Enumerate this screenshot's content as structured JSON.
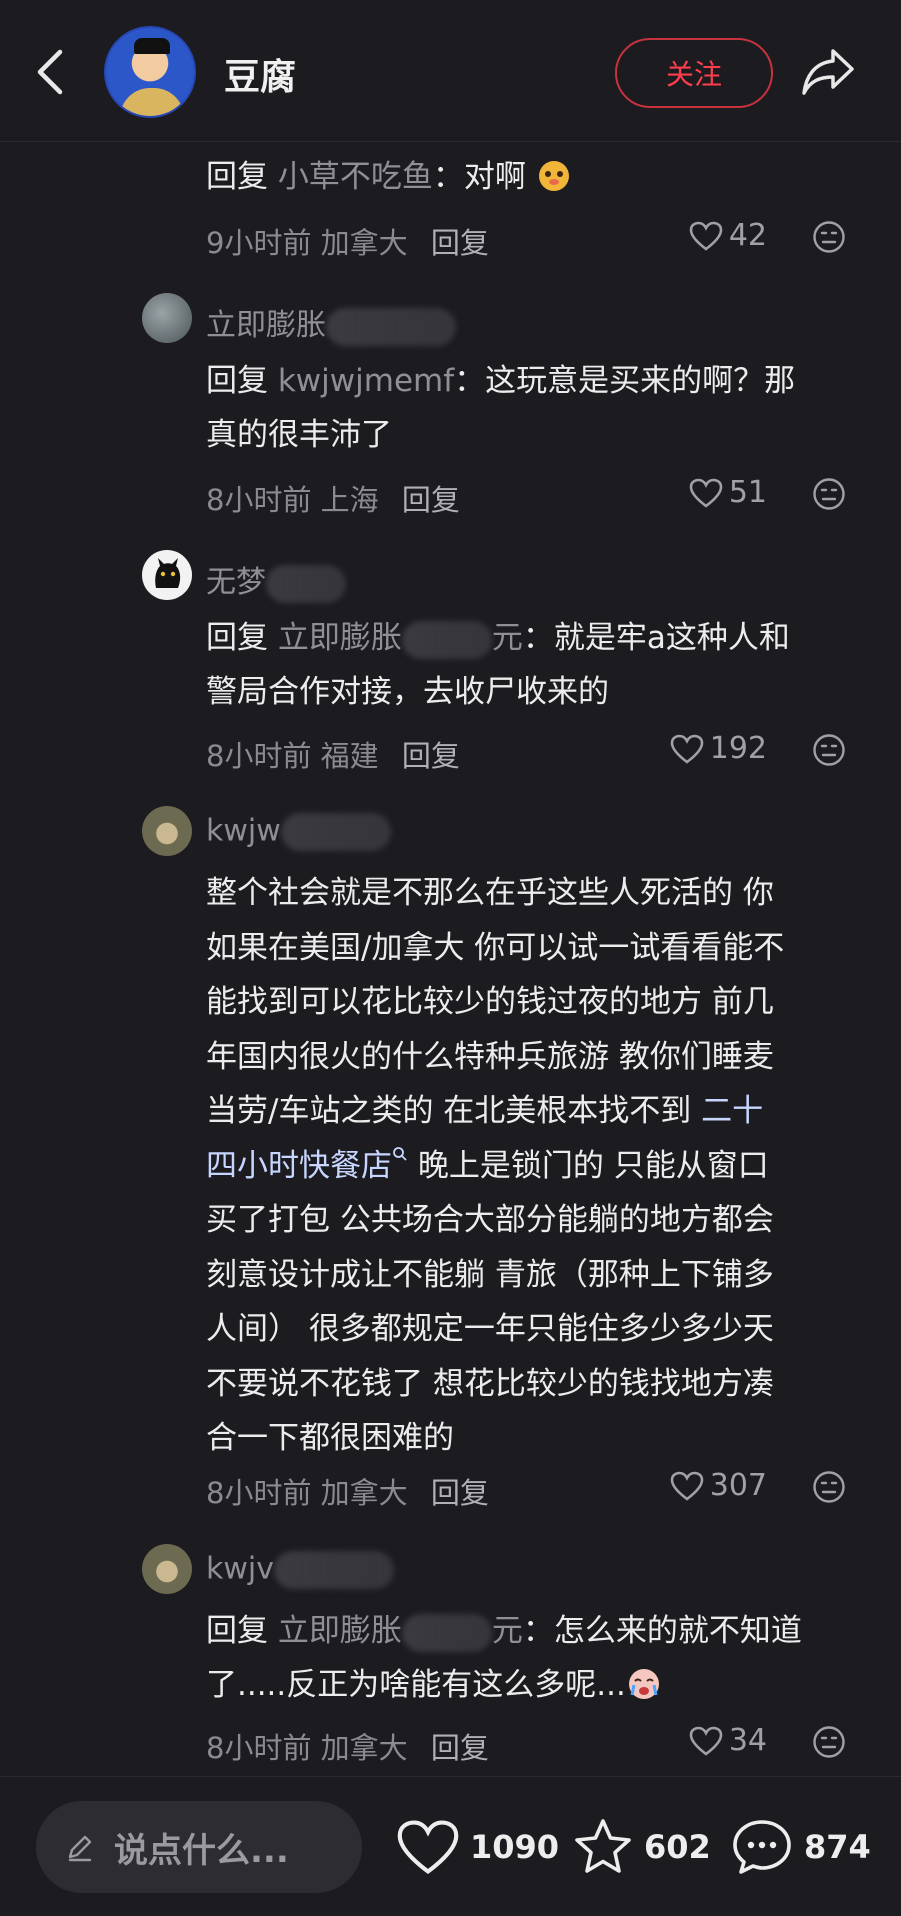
{
  "header": {
    "title": "豆腐",
    "follow_label": "关注"
  },
  "comments": [
    {
      "reply_kw": "回复",
      "target": "小草不吃鱼",
      "text": "：对啊",
      "time": "9小时前",
      "location": "加拿大",
      "reply_label": "回复",
      "likes": "42"
    },
    {
      "name": "立即膨胀",
      "reply_kw": "回复",
      "target": "kwjwjmemf",
      "text_line1": "：这玩意是买来的啊？那",
      "text_line2": "真的很丰沛了",
      "time": "8小时前",
      "location": "上海",
      "reply_label": "回复",
      "likes": "51"
    },
    {
      "name": "无梦",
      "reply_kw": "回复",
      "target_start": "立即膨胀",
      "target_end": "元",
      "text_line1": "：就是牢a这种人和",
      "text_line2": "警局合作对接，去收尸收来的",
      "time": "8小时前",
      "location": "福建",
      "reply_label": "回复",
      "likes": "192"
    },
    {
      "name": "kwjw",
      "lines": [
        "整个社会就是不那么在乎这些人死活的 你",
        "如果在美国/加拿大 你可以试一试看看能不",
        "能找到可以花比较少的钱过夜的地方 前几",
        "年国内很火的什么特种兵旅游 教你们睡麦",
        "当劳/车站之类的 在北美根本找不到 "
      ],
      "link_part1": "二十",
      "link_part2": "四小时快餐店",
      "after_link": " 晚上是锁门的 只能从窗口",
      "lines_after": [
        "买了打包 公共场合大部分能躺的地方都会",
        "刻意设计成让不能躺 青旅（那种上下铺多",
        "人间） 很多都规定一年只能住多少多少天",
        "不要说不花钱了 想花比较少的钱找地方凑",
        "合一下都很困难的"
      ],
      "time": "8小时前",
      "location": "加拿大",
      "reply_label": "回复",
      "likes": "307"
    },
    {
      "name": "kwjv",
      "reply_kw": "回复",
      "target_start": "立即膨胀",
      "target_end": "元",
      "text_line1": "：怎么来的就不知道",
      "text_line2": "了.....反正为啥能有这么多呢...",
      "time": "8小时前",
      "location": "加拿大",
      "reply_label": "回复",
      "likes": "34"
    }
  ],
  "bottom": {
    "input_placeholder": "说点什么...",
    "likes": "1090",
    "favorites": "602",
    "comments": "874"
  },
  "colors": {
    "background": "#1b1b20",
    "follow_red": "#ff3d4d",
    "link_blue": "#c7d6ff"
  },
  "icons": [
    "back-arrow-icon",
    "share-icon",
    "heart-icon",
    "dislike-face-icon",
    "pencil-icon",
    "star-icon",
    "comment-bubble-icon",
    "search-small-icon"
  ]
}
